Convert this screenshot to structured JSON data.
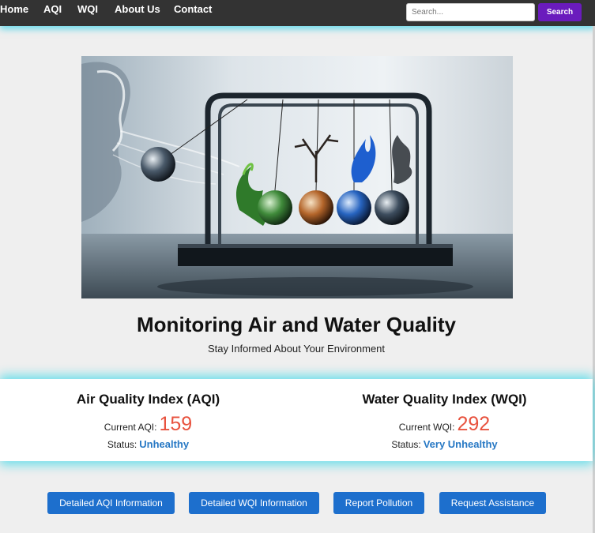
{
  "nav": {
    "links": [
      "Home",
      "AQI",
      "WQI",
      "About Us",
      "Contact"
    ],
    "search_placeholder": "Search...",
    "search_button": "Search"
  },
  "hero": {
    "title": "Monitoring Air and Water Quality",
    "subtitle": "Stay Informed About Your Environment"
  },
  "aqi": {
    "heading": "Air Quality Index (AQI)",
    "value_label": "Current AQI:",
    "value": "159",
    "status_label": "Status:",
    "status": "Unhealthy"
  },
  "wqi": {
    "heading": "Water Quality Index (WQI)",
    "value_label": "Current WQI:",
    "value": "292",
    "status_label": "Status:",
    "status": "Very Unhealthy"
  },
  "actions": [
    "Detailed AQI Information",
    "Detailed WQI Information",
    "Report Pollution",
    "Request Assistance"
  ],
  "colors": {
    "navbar": "#333333",
    "search_button": "#6a1bbd",
    "index_value": "#e8523e",
    "status": "#2778c4",
    "action_button": "#1d6fcd",
    "glow": "#00d2e6"
  }
}
